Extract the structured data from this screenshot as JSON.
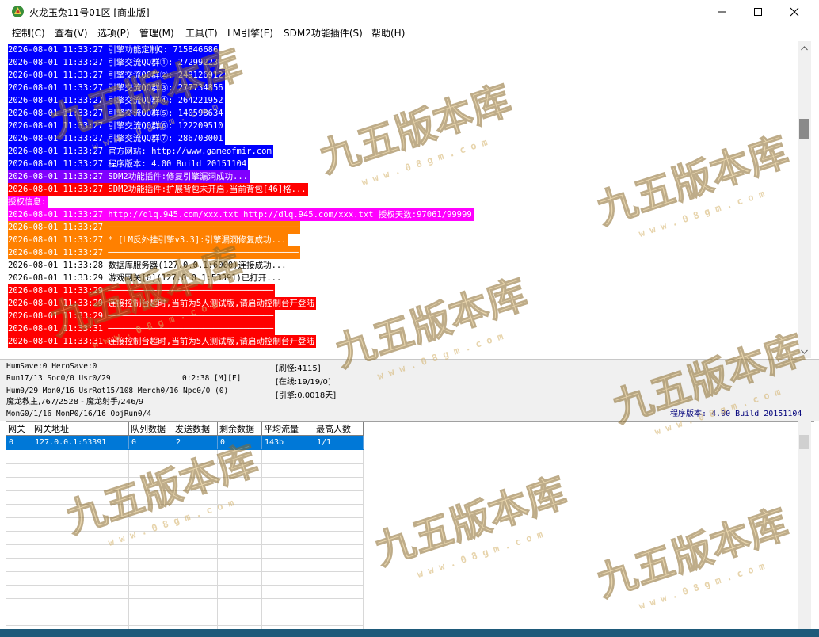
{
  "window": {
    "title": "火龙玉兔11号01区 [商业版]",
    "minimize_glyph": "—",
    "maximize_glyph": "☐",
    "close_glyph": "✕"
  },
  "menu": [
    "控制(C)",
    "查看(V)",
    "选项(P)",
    "管理(M)",
    "工具(T)",
    "LM引擎(E)",
    "SDM2功能插件(S)",
    "帮助(H)"
  ],
  "log": [
    {
      "text": "2026-08-01 11:33:27 引擎功能定制Q: 715846686",
      "bg": "#0000ff",
      "fg": "#ffffff"
    },
    {
      "text": "2026-08-01 11:33:27 引擎交流QQ群①: 27299223",
      "bg": "#0000ff",
      "fg": "#ffffff"
    },
    {
      "text": "2026-08-01 11:33:27 引擎交流QQ群②: 249126912",
      "bg": "#0000ff",
      "fg": "#ffffff"
    },
    {
      "text": "2026-08-01 11:33:27 引擎交流QQ群③: 277734856",
      "bg": "#0000ff",
      "fg": "#ffffff"
    },
    {
      "text": "2026-08-01 11:33:27 引擎交流QQ群④: 264221952",
      "bg": "#0000ff",
      "fg": "#ffffff"
    },
    {
      "text": "2026-08-01 11:33:27 引擎交流QQ群⑤: 140598634",
      "bg": "#0000ff",
      "fg": "#ffffff"
    },
    {
      "text": "2026-08-01 11:33:27 引擎交流QQ群⑥: 122209510",
      "bg": "#0000ff",
      "fg": "#ffffff"
    },
    {
      "text": "2026-08-01 11:33:27 引擎交流QQ群⑦: 286703001",
      "bg": "#0000ff",
      "fg": "#ffffff"
    },
    {
      "text": "2026-08-01 11:33:27 官方网站: http://www.gameofmir.com",
      "bg": "#0000ff",
      "fg": "#ffffff"
    },
    {
      "text": "2026-08-01 11:33:27 程序版本: 4.00 Build 20151104",
      "bg": "#0000ff",
      "fg": "#ffffff"
    },
    {
      "text": "2026-08-01 11:33:27 SDM2功能插件:修复引擎漏洞成功...",
      "bg": "#8000ff",
      "fg": "#ffffff"
    },
    {
      "text": "2026-08-01 11:33:27 SDM2功能插件:扩展背包未开启,当前背包[46]格...",
      "bg": "#ff0000",
      "fg": "#ffffff"
    },
    {
      "text": "授权信息:",
      "bg": "#ff00ff",
      "fg": "#ffffff"
    },
    {
      "text": "2026-08-01 11:33:27 http://dlq.945.com/xxx.txt http://dlq.945.com/xxx.txt 授权天数:97061/99999",
      "bg": "#ff00ff",
      "fg": "#ffffff"
    },
    {
      "text": "2026-08-01 11:33:27 ──────────────────────────────────────",
      "bg": "#ff8000",
      "fg": "#ffffff"
    },
    {
      "text": "2026-08-01 11:33:27 * [LM反外挂引擎v3.3]:引擎漏洞修复成功...",
      "bg": "#ff8000",
      "fg": "#ffffff"
    },
    {
      "text": "2026-08-01 11:33:27 ──────────────────────────────────────",
      "bg": "#ff8000",
      "fg": "#ffffff"
    },
    {
      "text": "2026-08-01 11:33:28 数据库服务器(127.0.0.1:6000)连接成功...",
      "bg": "",
      "fg": "#000000"
    },
    {
      "text": "2026-08-01 11:33:29 游戏网关[0](127.0.0.1:53391)已打开...",
      "bg": "",
      "fg": "#000000"
    },
    {
      "text": "2026-08-01 11:33:29 ─────────────────────────────────",
      "bg": "#ff0000",
      "fg": "#ffffff"
    },
    {
      "text": "2026-08-01 11:33:29 连接控制台超时,当前为5人测试版,请启动控制台开登陆",
      "bg": "#ff0000",
      "fg": "#ffffff"
    },
    {
      "text": "2026-08-01 11:33:29 ─────────────────────────────────",
      "bg": "#ff0000",
      "fg": "#ffffff"
    },
    {
      "text": "2026-08-01 11:33:31 ─────────────────────────────────",
      "bg": "#ff0000",
      "fg": "#ffffff"
    },
    {
      "text": "2026-08-01 11:33:31 连接控制台超时,当前为5人测试版,请启动控制台开登陆",
      "bg": "#ff0000",
      "fg": "#ffffff"
    }
  ],
  "status": {
    "line1": "HumSave:0 HeroSave:0",
    "line2": "Run17/13 Soc0/0 Usr0/29",
    "uptime": "0:2:38 [M][F]",
    "line3": "Hum0/29 Mon0/16 UsrRot15/108 Merch0/16 Npc0/0 (0)",
    "line4": "魔龙教主,767/2528 - 魔龙射手/246/9",
    "line5": "MonG0/1/16 MonP0/16/16 ObjRun0/4",
    "refresh": "[刷怪:4115]",
    "online": "[在线:19/19/0]",
    "engine": "[引擎:0.0018天]",
    "version": "程序版本: 4.00 Build 20151104"
  },
  "gate_table": {
    "headers": [
      "网关",
      "网关地址",
      "队列数据",
      "发送数据",
      "剩余数据",
      "平均流量",
      "最高人数"
    ],
    "rows": [
      [
        "0",
        "127.0.0.1:53391",
        "0",
        "2",
        "0",
        "143b",
        "1/1"
      ]
    ]
  },
  "watermark": {
    "brand": "九五版本库",
    "url": "w w w . 0 8 g m . c o m",
    "gold": "#d4b26a"
  }
}
